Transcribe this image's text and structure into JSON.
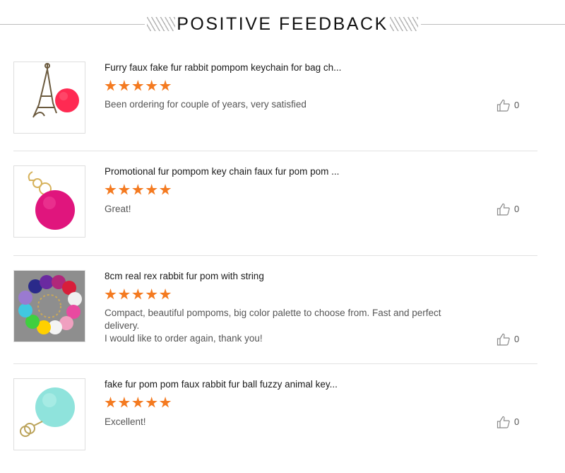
{
  "header": {
    "title": "POSITIVE FEEDBACK"
  },
  "reviews": [
    {
      "product_title": "Furry faux fake fur rabbit pompom keychain for bag ch...",
      "rating": 5,
      "comment": "Been ordering for couple of years, very satisfied",
      "likes": "0",
      "image": "eiffel-tower-red-pompom-keychain"
    },
    {
      "product_title": "Promotional fur pompom key chain faux fur pom pom ...",
      "rating": 5,
      "comment": "Great!",
      "likes": "0",
      "image": "pink-pompom-keychain"
    },
    {
      "product_title": "8cm real rex rabbit fur pom with string",
      "rating": 5,
      "comment": "Compact, beautiful pompoms, big color palette to choose from. Fast and perfect\n delivery.\nI would like to order again, thank you!",
      "likes": "0",
      "image": "multicolor-pompoms-circle"
    },
    {
      "product_title": "fake fur pom pom faux rabbit fur ball fuzzy animal key...",
      "rating": 5,
      "comment": "Excellent!",
      "likes": "0",
      "image": "mint-pompom-keychain"
    }
  ],
  "colors": {
    "star": "#f47a20",
    "divider": "#e2e2e2"
  }
}
